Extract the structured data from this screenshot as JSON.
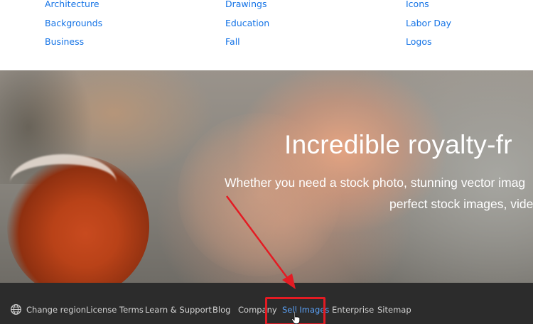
{
  "categories": {
    "columns": [
      [
        "Architecture",
        "Backgrounds",
        "Business"
      ],
      [
        "Drawings",
        "Education",
        "Fall"
      ],
      [
        "Icons",
        "Labor Day",
        "Logos"
      ]
    ]
  },
  "hero": {
    "title": "Incredible royalty-fr",
    "subtitle_line1": "Whether you need a stock photo, stunning vector imag",
    "subtitle_line2": "perfect stock images, vide"
  },
  "footer": {
    "items": [
      {
        "label": "Change region",
        "icon": "globe-icon"
      },
      {
        "label": "License Terms"
      },
      {
        "label": "Learn & Support"
      },
      {
        "label": "Blog"
      },
      {
        "label": "Company"
      },
      {
        "label": "Sell Images",
        "active": true
      },
      {
        "label": "Enterprise"
      },
      {
        "label": "Sitemap"
      }
    ]
  },
  "colors": {
    "link": "#1473e6",
    "footer_bg": "#2c2c2c",
    "footer_text": "#d3d3d3",
    "footer_active": "#5aa0f5",
    "annotation": "#e31b23"
  },
  "annotation": {
    "highlight_target": "Sell Images",
    "arrow": "red-arrow-icon",
    "cursor": "hand-pointer-icon"
  }
}
